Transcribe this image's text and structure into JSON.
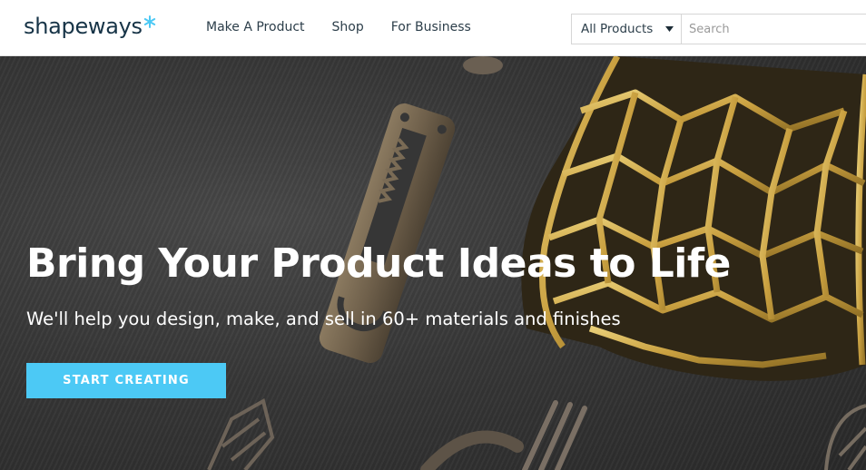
{
  "header": {
    "logo_text": "shapeways",
    "logo_icon": "star-icon",
    "nav": [
      {
        "label": "Make A Product"
      },
      {
        "label": "Shop"
      },
      {
        "label": "For Business"
      }
    ],
    "search": {
      "category": "All Products",
      "placeholder": "Search"
    }
  },
  "hero": {
    "title": "Bring Your Product Ideas to Life",
    "subtitle": "We'll help you design, make, and sell in 60+ materials and finishes",
    "cta_label": "START CREATING"
  },
  "colors": {
    "brand_dark": "#173447",
    "accent": "#4cc9f5",
    "hero_bg": "#3a3a3a"
  }
}
